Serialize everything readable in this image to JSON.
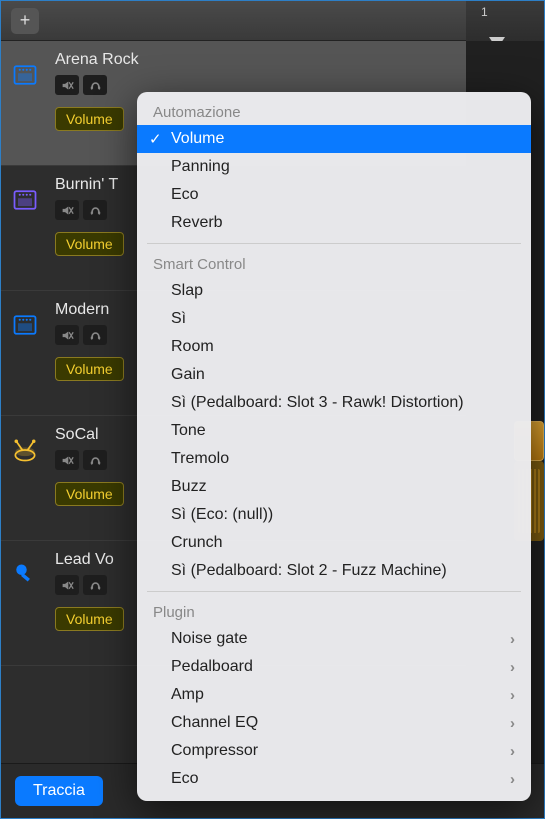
{
  "ruler": {
    "marker": "1"
  },
  "tracks": [
    {
      "name": "Arena Rock",
      "param": "Volume",
      "color": "#0a7aff",
      "icon": "amp",
      "selected": true
    },
    {
      "name": "Burnin' T",
      "param": "Volume",
      "color": "#7a5cff",
      "icon": "amp",
      "selected": false
    },
    {
      "name": "Modern",
      "param": "Volume",
      "color": "#0a7aff",
      "icon": "amp",
      "selected": false
    },
    {
      "name": "SoCal",
      "param": "Volume",
      "color": "#f5c030",
      "icon": "drums",
      "selected": false
    },
    {
      "name": "Lead Vo",
      "param": "Volume",
      "color": "#0a7aff",
      "icon": "mic",
      "selected": false
    }
  ],
  "menu": {
    "sections": [
      {
        "label": "Automazione",
        "items": [
          {
            "label": "Volume",
            "selected": true
          },
          {
            "label": "Panning"
          },
          {
            "label": "Eco"
          },
          {
            "label": "Reverb"
          }
        ]
      },
      {
        "label": "Smart Control",
        "items": [
          {
            "label": "Slap"
          },
          {
            "label": "Sì"
          },
          {
            "label": "Room"
          },
          {
            "label": "Gain"
          },
          {
            "label": "Sì (Pedalboard: Slot 3 - Rawk! Distortion)"
          },
          {
            "label": "Tone"
          },
          {
            "label": "Tremolo"
          },
          {
            "label": "Buzz"
          },
          {
            "label": "Sì (Eco: (null))"
          },
          {
            "label": "Crunch"
          },
          {
            "label": "Sì (Pedalboard: Slot 2 - Fuzz Machine)"
          }
        ]
      },
      {
        "label": "Plugin",
        "items": [
          {
            "label": "Noise gate",
            "submenu": true
          },
          {
            "label": "Pedalboard",
            "submenu": true
          },
          {
            "label": "Amp",
            "submenu": true
          },
          {
            "label": "Channel EQ",
            "submenu": true
          },
          {
            "label": "Compressor",
            "submenu": true
          },
          {
            "label": "Eco",
            "submenu": true
          }
        ]
      }
    ]
  },
  "footer": {
    "tab": "Traccia"
  },
  "icons": {
    "mute": "mute-icon",
    "headphones": "headphones-icon"
  }
}
